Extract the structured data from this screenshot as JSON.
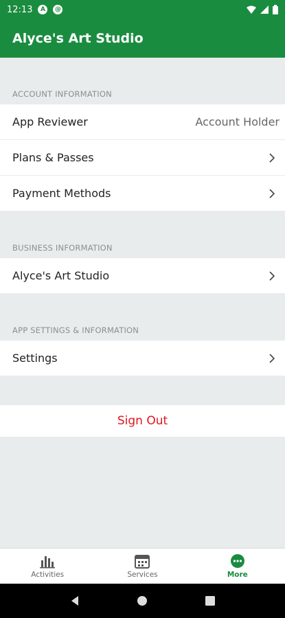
{
  "status": {
    "time": "12:13"
  },
  "header": {
    "title": "Alyce's Art Studio"
  },
  "account": {
    "section_title": "ACCOUNT INFORMATION",
    "name": "App Reviewer",
    "role": "Account Holder",
    "plans_label": "Plans & Passes",
    "payment_label": "Payment Methods"
  },
  "business": {
    "section_title": "BUSINESS INFORMATION",
    "studio_label": "Alyce's Art Studio"
  },
  "app_settings": {
    "section_title": "APP SETTINGS & INFORMATION",
    "settings_label": "Settings"
  },
  "signout_label": "Sign Out",
  "nav": {
    "activities": "Activities",
    "services": "Services",
    "more": "More"
  },
  "colors": {
    "brand": "#1a8c3f",
    "danger": "#e0151d"
  }
}
